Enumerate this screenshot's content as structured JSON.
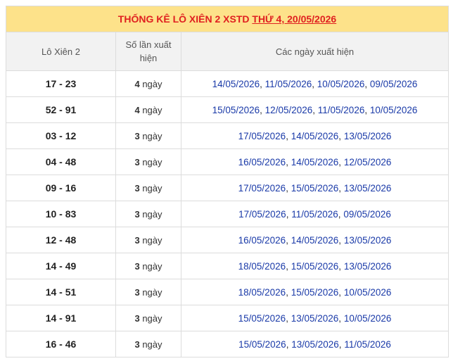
{
  "title": {
    "prefix": "THỐNG KÊ LÔ XIÊN 2 XSTD ",
    "date_label": "THỨ 4, 20/05/2026"
  },
  "columns": {
    "pair": "Lô Xiên 2",
    "count": "Số lần xuất hiện",
    "dates": "Các ngày xuất hiện"
  },
  "rows": [
    {
      "pair": "17 - 23",
      "count": "4",
      "unit": " ngày",
      "dates": [
        "14/05/2026",
        "11/05/2026",
        "10/05/2026",
        "09/05/2026"
      ]
    },
    {
      "pair": "52 - 91",
      "count": "4",
      "unit": " ngày",
      "dates": [
        "15/05/2026",
        "12/05/2026",
        "11/05/2026",
        "10/05/2026"
      ]
    },
    {
      "pair": "03 - 12",
      "count": "3",
      "unit": " ngày",
      "dates": [
        "17/05/2026",
        "14/05/2026",
        "13/05/2026"
      ]
    },
    {
      "pair": "04 - 48",
      "count": "3",
      "unit": " ngày",
      "dates": [
        "16/05/2026",
        "14/05/2026",
        "12/05/2026"
      ]
    },
    {
      "pair": "09 - 16",
      "count": "3",
      "unit": " ngày",
      "dates": [
        "17/05/2026",
        "15/05/2026",
        "13/05/2026"
      ]
    },
    {
      "pair": "10 - 83",
      "count": "3",
      "unit": " ngày",
      "dates": [
        "17/05/2026",
        "11/05/2026",
        "09/05/2026"
      ]
    },
    {
      "pair": "12 - 48",
      "count": "3",
      "unit": " ngày",
      "dates": [
        "16/05/2026",
        "14/05/2026",
        "13/05/2026"
      ]
    },
    {
      "pair": "14 - 49",
      "count": "3",
      "unit": " ngày",
      "dates": [
        "18/05/2026",
        "15/05/2026",
        "13/05/2026"
      ]
    },
    {
      "pair": "14 - 51",
      "count": "3",
      "unit": " ngày",
      "dates": [
        "18/05/2026",
        "15/05/2026",
        "10/05/2026"
      ]
    },
    {
      "pair": "14 - 91",
      "count": "3",
      "unit": " ngày",
      "dates": [
        "15/05/2026",
        "13/05/2026",
        "10/05/2026"
      ]
    },
    {
      "pair": "16 - 46",
      "count": "3",
      "unit": " ngày",
      "dates": [
        "15/05/2026",
        "13/05/2026",
        "11/05/2026"
      ]
    }
  ]
}
